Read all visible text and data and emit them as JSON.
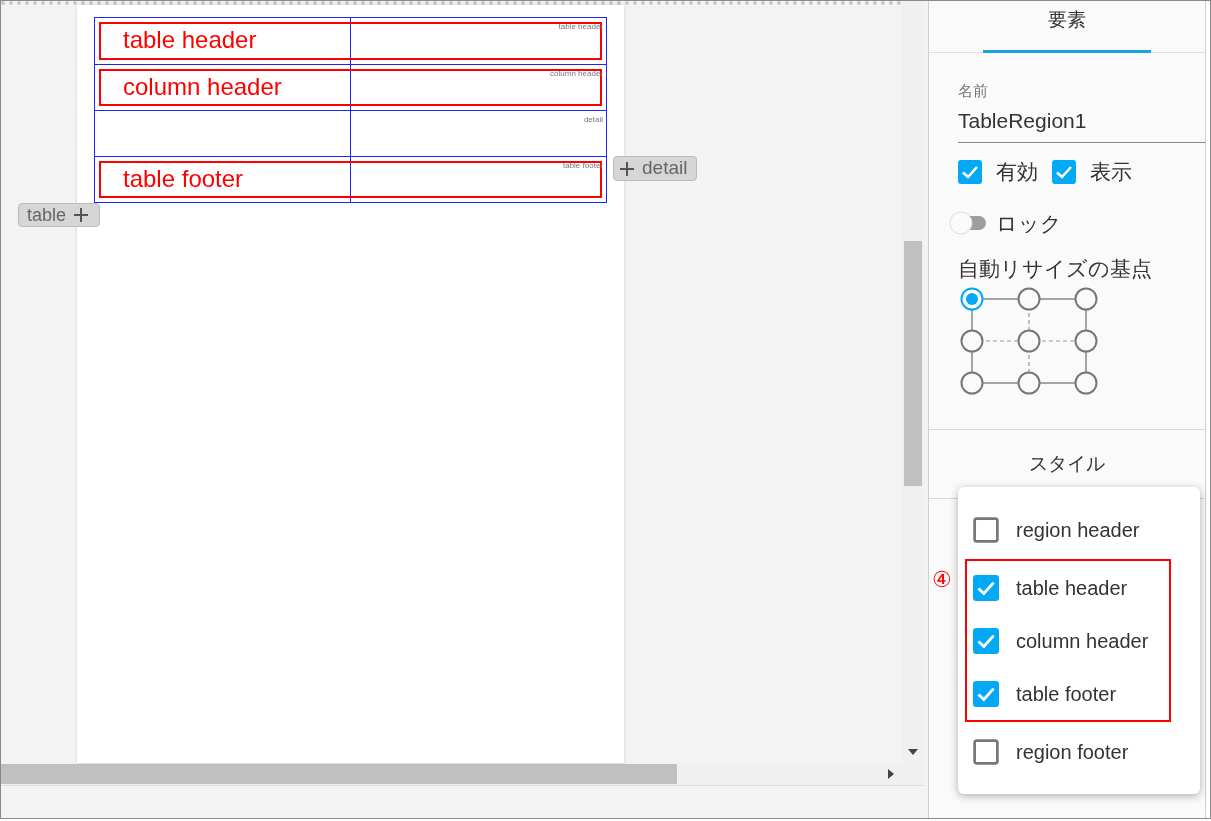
{
  "canvas": {
    "table_region": {
      "rows": [
        {
          "tag": "table header",
          "annotation": "table header"
        },
        {
          "tag": "column header",
          "annotation": "column header"
        },
        {
          "tag": "detail"
        },
        {
          "tag": "table footer",
          "annotation": "table footer"
        }
      ]
    },
    "add_table_button": {
      "label": "table"
    },
    "add_detail_button": {
      "label": "detail"
    }
  },
  "properties_panel": {
    "tabs": [
      {
        "label": "要素",
        "selected": true
      }
    ],
    "name_field": {
      "label": "名前",
      "value": "TableRegion1"
    },
    "checkboxes": [
      {
        "label": "有効",
        "checked": true
      },
      {
        "label": "表示",
        "checked": true
      }
    ],
    "lock_toggle": {
      "label": "ロック",
      "on": false
    },
    "resize_anchor": {
      "label": "自動リサイズの基点",
      "points": [
        {
          "selected": true
        },
        {
          "selected": false
        },
        {
          "selected": false
        },
        {
          "selected": false
        },
        {
          "selected": false
        },
        {
          "selected": false
        },
        {
          "selected": false
        },
        {
          "selected": false
        },
        {
          "selected": false
        }
      ]
    },
    "style_section": {
      "title": "スタイル"
    }
  },
  "dropdown_menu": {
    "annotation_marker": "④",
    "items": [
      {
        "label": "region header",
        "checked": false,
        "highlighted": false
      },
      {
        "label": "table header",
        "checked": true,
        "highlighted": true
      },
      {
        "label": "column header",
        "checked": true,
        "highlighted": true
      },
      {
        "label": "table footer",
        "checked": true,
        "highlighted": true
      },
      {
        "label": "region footer",
        "checked": false,
        "highlighted": false
      }
    ]
  }
}
